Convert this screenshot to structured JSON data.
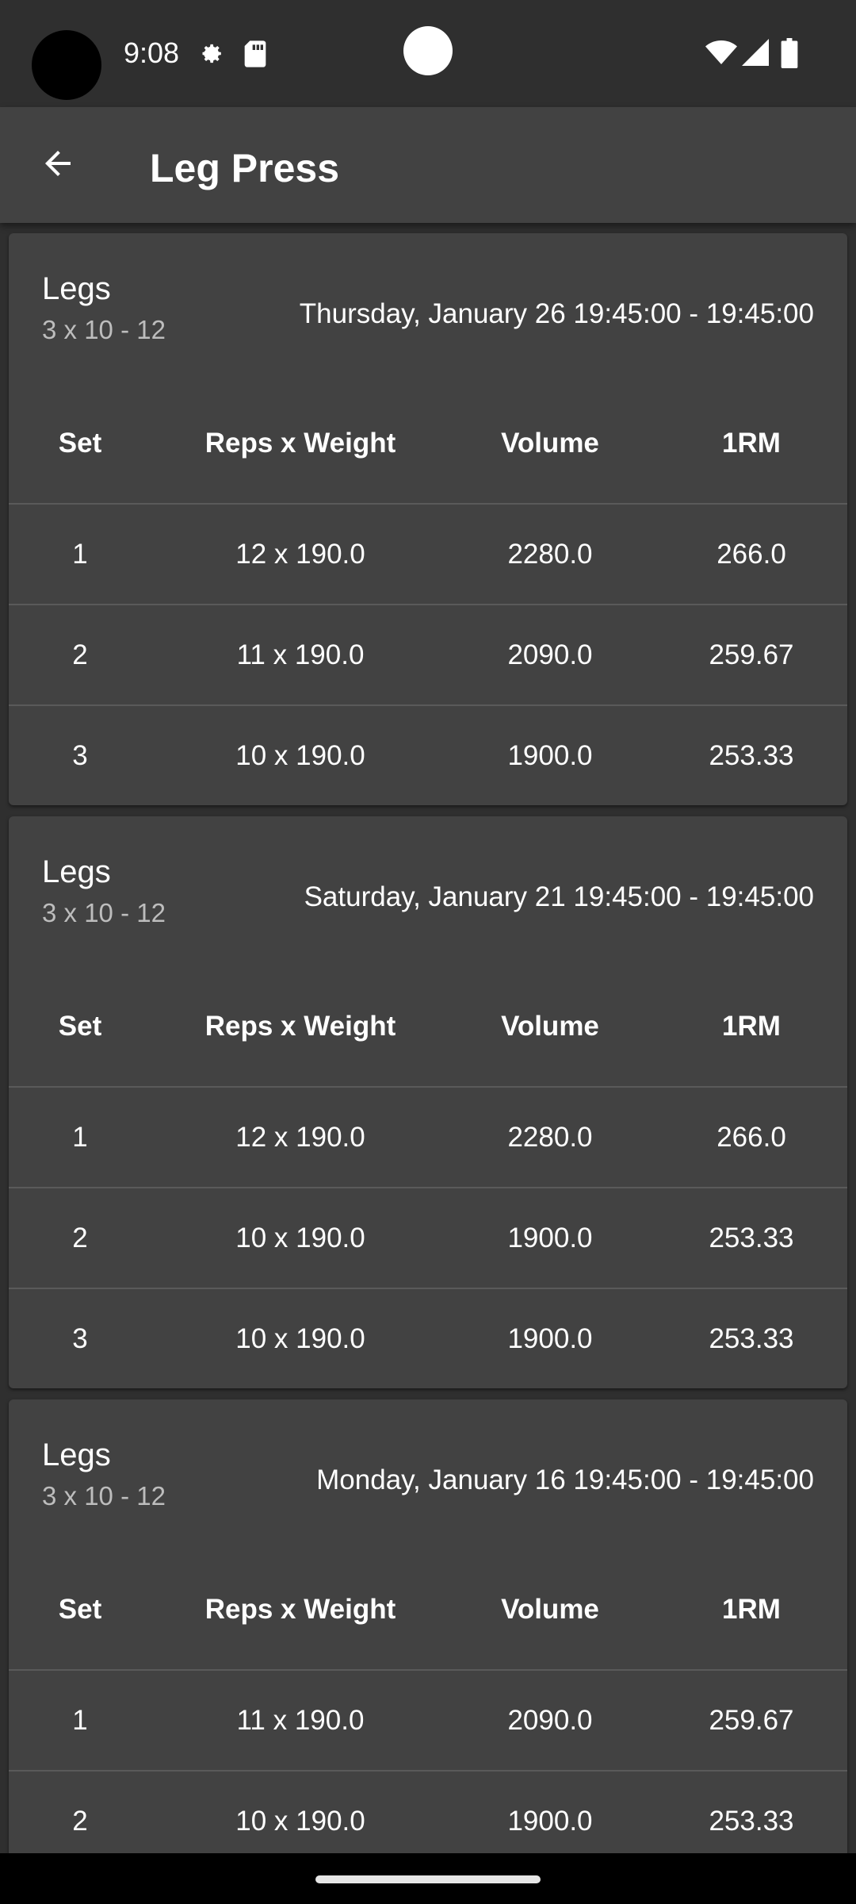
{
  "status_bar": {
    "time": "9:08",
    "icons": [
      "settings-icon",
      "sd-card-icon",
      "wifi-icon",
      "signal-icon",
      "battery-icon"
    ]
  },
  "app_bar": {
    "title": "Leg Press",
    "back_icon": "arrow-back-icon"
  },
  "table_headers": {
    "set": "Set",
    "reps_weight": "Reps x Weight",
    "volume": "Volume",
    "one_rm": "1RM"
  },
  "workouts": [
    {
      "name": "Legs",
      "scheme": "3 x 10 - 12",
      "date": "Thursday, January 26 19:45:00 - 19:45:00",
      "sets": [
        {
          "set": "1",
          "reps_weight": "12 x 190.0",
          "volume": "2280.0",
          "one_rm": "266.0"
        },
        {
          "set": "2",
          "reps_weight": "11 x 190.0",
          "volume": "2090.0",
          "one_rm": "259.67"
        },
        {
          "set": "3",
          "reps_weight": "10 x 190.0",
          "volume": "1900.0",
          "one_rm": "253.33"
        }
      ]
    },
    {
      "name": "Legs",
      "scheme": "3 x 10 - 12",
      "date": "Saturday, January 21 19:45:00 - 19:45:00",
      "sets": [
        {
          "set": "1",
          "reps_weight": "12 x 190.0",
          "volume": "2280.0",
          "one_rm": "266.0"
        },
        {
          "set": "2",
          "reps_weight": "10 x 190.0",
          "volume": "1900.0",
          "one_rm": "253.33"
        },
        {
          "set": "3",
          "reps_weight": "10 x 190.0",
          "volume": "1900.0",
          "one_rm": "253.33"
        }
      ]
    },
    {
      "name": "Legs",
      "scheme": "3 x 10 - 12",
      "date": "Monday, January 16 19:45:00 - 19:45:00",
      "sets": [
        {
          "set": "1",
          "reps_weight": "11 x 190.0",
          "volume": "2090.0",
          "one_rm": "259.67"
        },
        {
          "set": "2",
          "reps_weight": "10 x 190.0",
          "volume": "1900.0",
          "one_rm": "253.33"
        }
      ]
    }
  ],
  "colors": {
    "background": "#2f2f2f",
    "card": "#424242",
    "appbar": "#424242",
    "divider": "#5a5a5a",
    "secondary_text": "#bdbdbd"
  }
}
